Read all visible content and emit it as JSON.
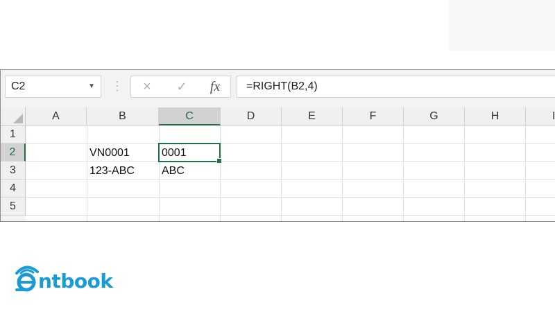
{
  "formula_bar": {
    "name_box": "C2",
    "formula": "=RIGHT(B2,4)",
    "cancel_icon": "×",
    "enter_icon": "✓",
    "function_icon": "fx"
  },
  "grid": {
    "columns": [
      "A",
      "B",
      "C",
      "D",
      "E",
      "F",
      "G",
      "H",
      "I"
    ],
    "rows": [
      "1",
      "2",
      "3",
      "4",
      "5"
    ],
    "selected_column": "C",
    "selected_row": "2",
    "cells": {
      "B2": "VN0001",
      "C2": "0001",
      "B3": "123-ABC",
      "C3": "ABC"
    }
  },
  "brand": {
    "logo_text": "ntbook",
    "color": "#1b9bd6"
  },
  "colors": {
    "excel_green": "#217346"
  }
}
